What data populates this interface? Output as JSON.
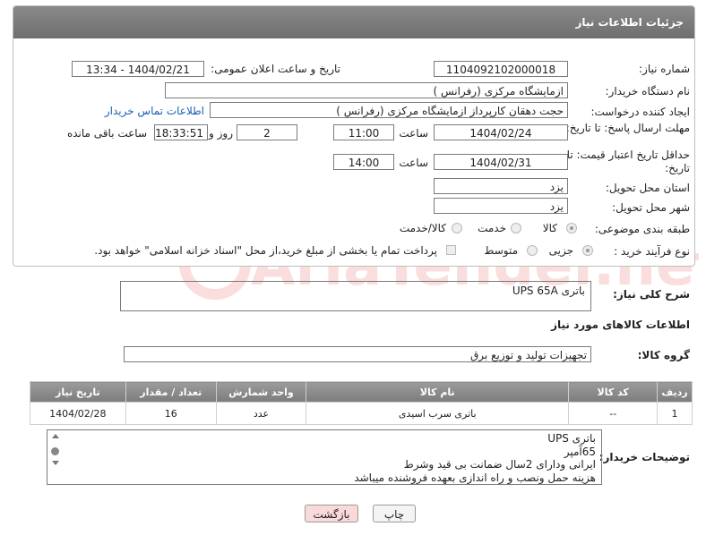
{
  "header": {
    "title": "جزئیات اطلاعات نیاز"
  },
  "fields": {
    "need_number_label": "شماره نیاز:",
    "need_number": "1104092102000018",
    "announce_label": "تاریخ و ساعت اعلان عمومی:",
    "announce_value": "1404/02/21 - 13:34",
    "buyer_org_label": "نام دستگاه خریدار:",
    "buyer_org": "ازمایشگاه مرکزی (رفرانس )",
    "creator_label": "ایجاد کننده درخواست:",
    "creator": "حجت دهقان کارپرداز ازمایشگاه مرکزی (رفرانس )",
    "contact_link": "اطلاعات تماس خریدار",
    "reply_deadline_label": "مهلت ارسال پاسخ: تا تاریخ:",
    "reply_date": "1404/02/24",
    "time_label": "ساعت",
    "reply_time": "11:00",
    "days_value": "2",
    "days_label": "روز و",
    "remaining_time": "18:33:51",
    "remaining_label": "ساعت باقی مانده",
    "price_validity_label": "حداقل تاریخ اعتبار قیمت: تا تاریخ:",
    "price_date": "1404/02/31",
    "price_time": "14:00",
    "province_label": "استان محل تحویل:",
    "province": "یزد",
    "city_label": "شهر محل تحویل:",
    "city": "یزد",
    "category_label": "طبقه بندی موضوعی:",
    "category_options": [
      "کالا",
      "خدمت",
      "کالا/خدمت"
    ],
    "process_label": "نوع فرآیند خرید :",
    "process_options": [
      "جزیی",
      "متوسط"
    ],
    "payment_note": "پرداخت تمام یا بخشی از مبلغ خرید،از محل \"اسناد خزانه اسلامی\" خواهد بود."
  },
  "summary": {
    "label": "شرح کلی نیاز:",
    "value": "باتری UPS 65A"
  },
  "goods_section_title": "اطلاعات کالاهای مورد نیاز",
  "goods_group": {
    "label": "گروه کالا:",
    "value": "تجهیزات تولید و توزیع برق"
  },
  "table": {
    "headers": [
      "ردیف",
      "کد کالا",
      "نام کالا",
      "واحد شمارش",
      "تعداد / مقدار",
      "تاریخ نیاز"
    ],
    "rows": [
      [
        "1",
        "--",
        "باتری سرب اسیدی",
        "عدد",
        "16",
        "1404/02/28"
      ]
    ]
  },
  "buyer_notes": {
    "label": "توضیحات خریدار:",
    "lines": [
      "باتری UPS",
      "65آمپر",
      "ایرانی ودارای 2سال ضمانت بی قید وشرط",
      "هزینه حمل ونصب و راه اندازی بعهده فروشنده میباشد"
    ]
  },
  "buttons": {
    "print": "چاپ",
    "back": "بازگشت"
  },
  "colors": {
    "header_bg": "#7a7a7a",
    "back_button_bg": "#f9d9d9",
    "link": "#1a5fb4"
  },
  "watermark": {
    "text": "AriaTender.net"
  }
}
